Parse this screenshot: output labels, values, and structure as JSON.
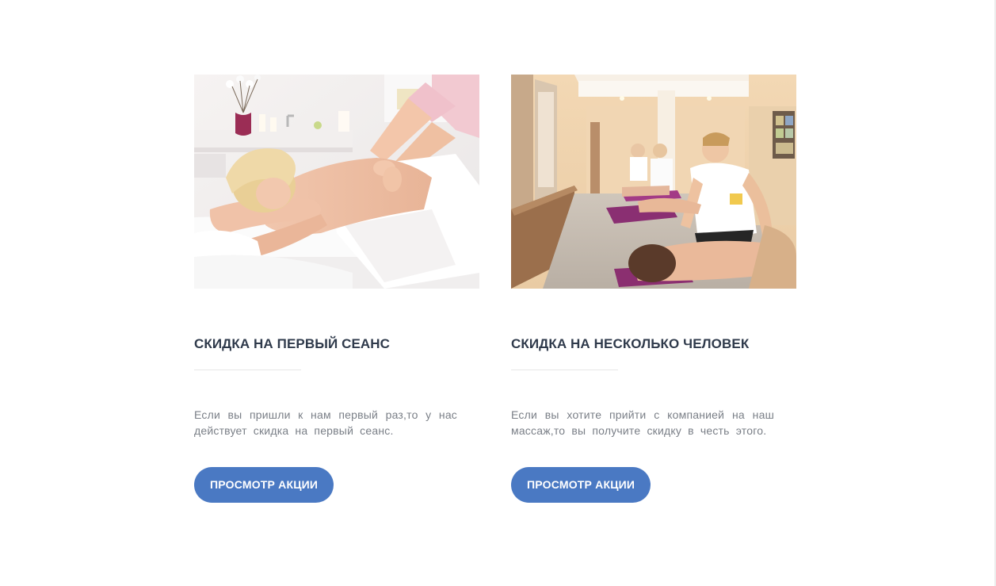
{
  "offers": [
    {
      "title": "СКИДКА НА ПЕРВЫЙ СЕАНС",
      "description": "Если вы пришли к нам первый раз,то у нас действует скидка на первый сеанс.",
      "button_label": "ПРОСМОТР АКЦИИ",
      "image": "spa-massage-photo"
    },
    {
      "title": "СКИДКА НА НЕСКОЛЬКО ЧЕЛОВЕК",
      "description": "Если вы хотите прийти с компанией на наш массаж,то вы получите скидку в честь этого.",
      "button_label": "ПРОСМОТР АКЦИИ",
      "image": "group-massage-photo"
    }
  ],
  "colors": {
    "button": "#4a79c3",
    "title": "#2f3a4b",
    "text": "#7a7f87",
    "divider": "#e7e7e7"
  }
}
